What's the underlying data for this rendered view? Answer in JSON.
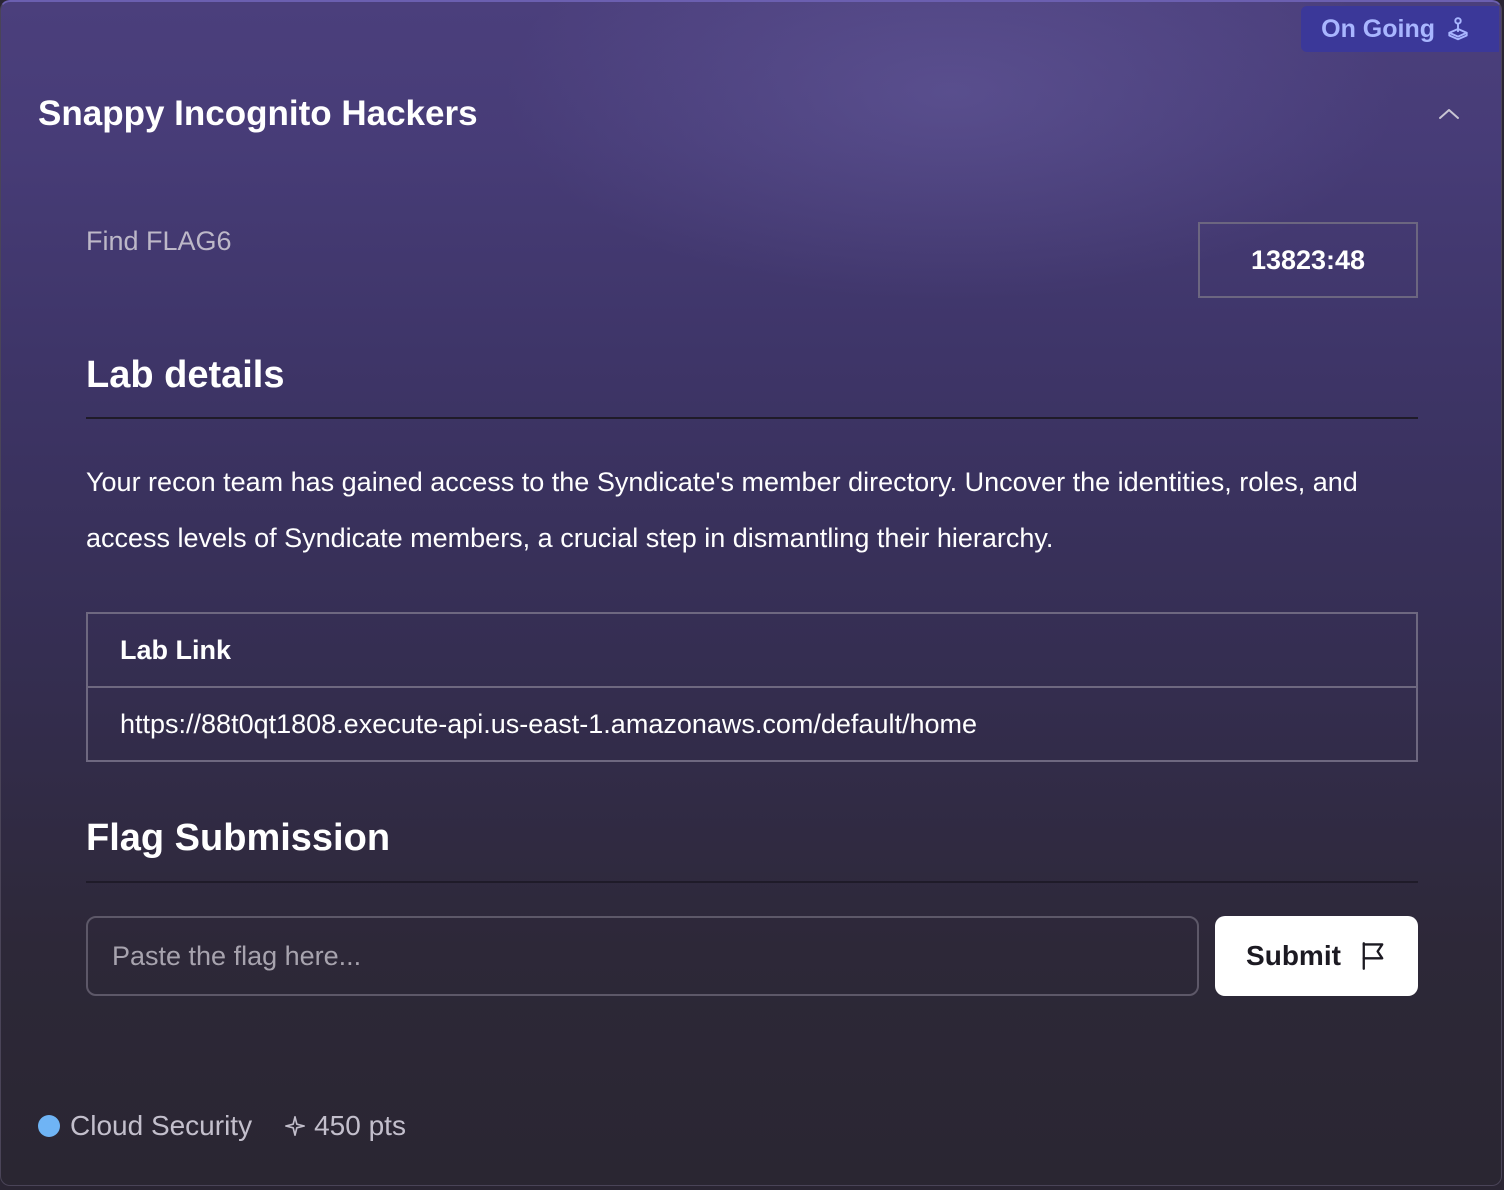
{
  "status_badge": {
    "label": "On Going",
    "icon": "joystick-icon"
  },
  "challenge": {
    "title": "Snappy Incognito Hackers",
    "task": "Find FLAG6",
    "timer": "13823:48"
  },
  "lab_details": {
    "heading": "Lab details",
    "description": "Your recon team has gained access to the Syndicate's member directory. Uncover the identities, roles, and access levels of Syndicate members, a crucial step in dismantling their hierarchy.",
    "table_header": "Lab Link",
    "link": "https://88t0qt1808.execute-api.us-east-1.amazonaws.com/default/home"
  },
  "flag_submission": {
    "heading": "Flag Submission",
    "placeholder": "Paste the flag here...",
    "submit_label": "Submit"
  },
  "footer": {
    "category": "Cloud Security",
    "category_color": "#6fb4f5",
    "points": "450 pts"
  },
  "colors": {
    "badge_bg": "#3b3899",
    "badge_text": "#a9b6ff",
    "card_top": "#4b3f7c",
    "card_bottom": "#2a2632"
  }
}
